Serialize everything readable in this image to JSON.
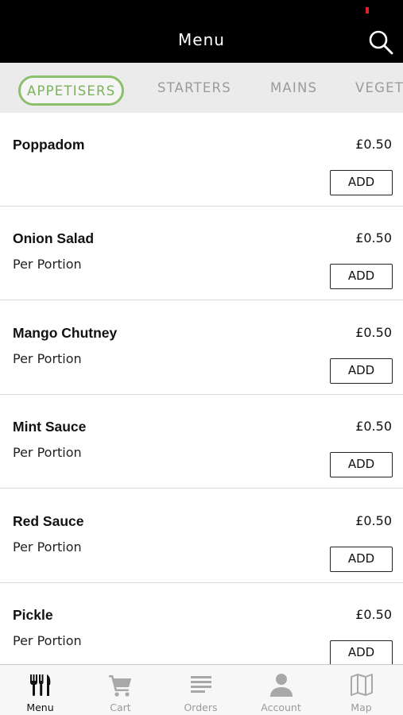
{
  "header": {
    "title": "Menu"
  },
  "tabs": [
    {
      "label": "APPETISERS",
      "active": true
    },
    {
      "label": "STARTERS",
      "active": false
    },
    {
      "label": "MAINS",
      "active": false
    },
    {
      "label": "VEGETABLES",
      "active": false
    }
  ],
  "items": [
    {
      "name": "Poppadom",
      "price": "£0.50",
      "description": "",
      "button": "ADD"
    },
    {
      "name": "Onion Salad",
      "price": "£0.50",
      "description": "Per Portion",
      "button": "ADD"
    },
    {
      "name": "Mango Chutney",
      "price": "£0.50",
      "description": "Per Portion",
      "button": "ADD"
    },
    {
      "name": "Mint Sauce",
      "price": "£0.50",
      "description": "Per Portion",
      "button": "ADD"
    },
    {
      "name": "Red Sauce",
      "price": "£0.50",
      "description": "Per Portion",
      "button": "ADD"
    },
    {
      "name": "Pickle",
      "price": "£0.50",
      "description": "Per Portion",
      "button": "ADD"
    }
  ],
  "nav": [
    {
      "label": "Menu",
      "icon": "fork-knife-icon",
      "active": true
    },
    {
      "label": "Cart",
      "icon": "cart-icon",
      "active": false
    },
    {
      "label": "Orders",
      "icon": "orders-list-icon",
      "active": false
    },
    {
      "label": "Account",
      "icon": "user-icon",
      "active": false
    },
    {
      "label": "Map",
      "icon": "map-icon",
      "active": false
    }
  ],
  "colors": {
    "header_bg": "#000000",
    "accent_green": "#7bb25a",
    "tab_bar_bg": "#ebebeb",
    "nav_inactive": "#9a9a9a"
  }
}
